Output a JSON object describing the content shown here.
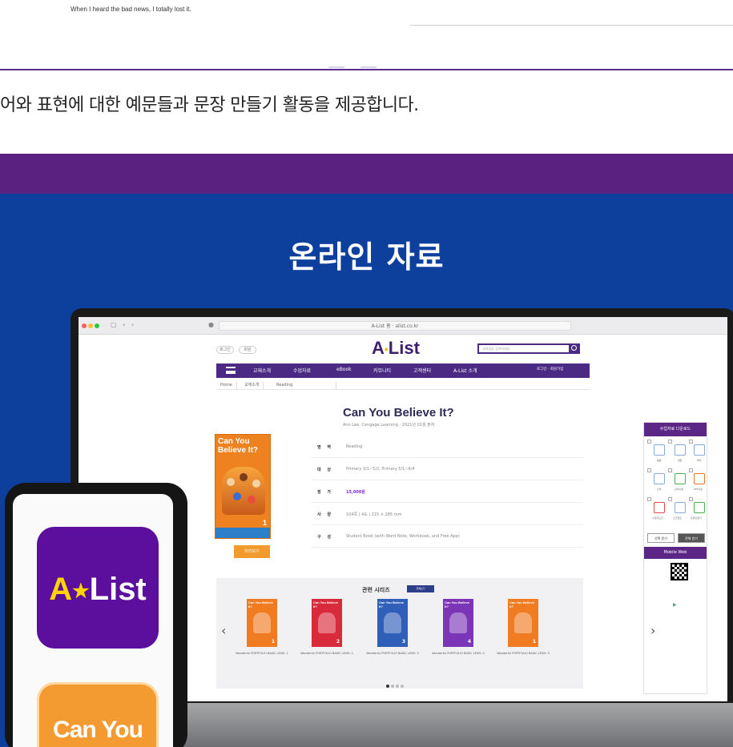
{
  "top": {
    "example_sentence": "When I heard the bad news, I totally lost it.",
    "description": "어와 표현에 대한 예문들과 문장 만들기 활동을 제공합니다."
  },
  "section": {
    "title": "온라인 자료"
  },
  "browser": {
    "url": "A-List 홈 · alist.co.kr",
    "pills": [
      "로그인",
      "회원"
    ],
    "logo_a": "A",
    "logo_list": "List",
    "search_placeholder": "교재명을 검색하세요",
    "nav": [
      "교재소개",
      "수업자료",
      "eBook",
      "커뮤니티",
      "고객센터",
      "A-List 소개"
    ],
    "nav_right": "로그인 · 회원가입",
    "crumbs": [
      "Home",
      "교재소개",
      "Reading"
    ]
  },
  "book": {
    "title": "Can You Believe It?",
    "subtitle": "Ann Lee, Cengage Learning · 2021년 01월 출처",
    "cover_title": "Can You Believe It?",
    "cover_num": "1",
    "preview_label": "미리보기",
    "info": [
      {
        "key": "영 역",
        "value": "Reading"
      },
      {
        "key": "대 상",
        "value": "Primary 3/1~5/2, Primary 5/1~6/4"
      },
      {
        "key": "정 가",
        "value": "15,000원"
      },
      {
        "key": "사 양",
        "value": "104쪽 | 4도 | 215 × 285 mm"
      },
      {
        "key": "구 성",
        "value": "Student Book (with Word Note, Workbook, and Free App)"
      }
    ]
  },
  "side": {
    "header": "수업자료 다운로드",
    "labels": [
      "음원",
      "정답",
      "해석",
      "단어",
      "단어시험",
      "PPT자료",
      "수업지도안",
      "스크립트",
      "온라인평가"
    ],
    "btn_select": "선택 받기",
    "btn_all": "전체 받기",
    "mobile_web": "Mobile Web"
  },
  "series": {
    "title": "관련 시리즈",
    "tag": "전체보기",
    "books": [
      {
        "num": "1",
        "caption": "Wonderful PORTFOLIO BASIC LEVEL 1",
        "color": "#f07b21"
      },
      {
        "num": "2",
        "caption": "Wonderful PORTFOLIO BASIC LEVEL 2",
        "color": "#d82a3a"
      },
      {
        "num": "3",
        "caption": "Wonderful PORTFOLIO BASIC LEVEL 3",
        "color": "#2f5fb8"
      },
      {
        "num": "4",
        "caption": "Wonderful PORTFOLIO BASIC LEVEL 4",
        "color": "#7a36b6"
      },
      {
        "num": "1",
        "caption": "Wonderful PORTFOLIO BASIC LEVEL 5",
        "color": "#f07b21"
      }
    ],
    "mini_title": "Can You Believe It?",
    "arrow_prev": "‹",
    "arrow_next": "›"
  },
  "phone": {
    "app_logo_a": "A",
    "app_logo_star": "★",
    "app_logo_list": "List",
    "app2_text": "Can You"
  },
  "colors": {
    "purple": "#5a2181",
    "blue": "#0d3f9c",
    "accent_yellow": "#ffd400",
    "orange": "#f39a31"
  }
}
